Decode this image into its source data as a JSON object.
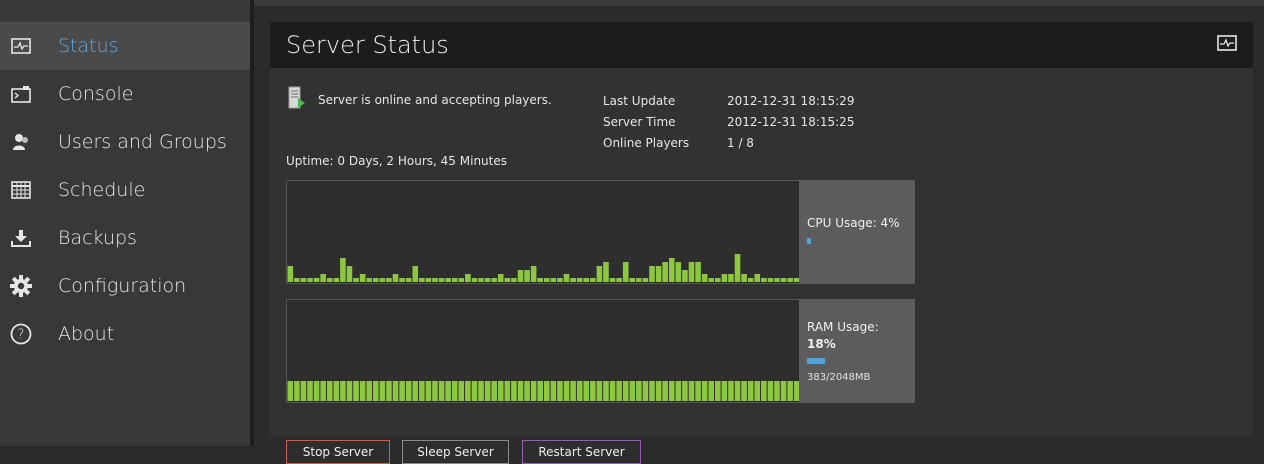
{
  "sidebar": {
    "items": [
      {
        "label": "Status",
        "icon": "activity-monitor-icon",
        "active": true
      },
      {
        "label": "Console",
        "icon": "console-icon"
      },
      {
        "label": "Users and Groups",
        "icon": "users-icon"
      },
      {
        "label": "Schedule",
        "icon": "calendar-grid-icon"
      },
      {
        "label": "Backups",
        "icon": "download-tray-icon"
      },
      {
        "label": "Configuration",
        "icon": "gear-icon"
      },
      {
        "label": "About",
        "icon": "help-circle-icon"
      }
    ]
  },
  "panel": {
    "title": "Server Status",
    "header_icon": "activity-monitor-icon",
    "status_text": "Server is online and accepting players.",
    "uptime": {
      "prefix": "Uptime: ",
      "days": "0",
      "days_unit": " Days, ",
      "hours": "2",
      "hours_unit": " Hours, ",
      "minutes": "45",
      "minutes_unit": " Minutes"
    },
    "info": [
      {
        "key": "Last Update",
        "value": "2012-12-31 18:15:29"
      },
      {
        "key": "Server Time",
        "value": "2012-12-31 18:15:25"
      },
      {
        "key": "Online Players",
        "value": "1 / 8"
      }
    ],
    "cpu": {
      "label": "CPU Usage: 4%",
      "percent": 4,
      "history": [
        4,
        1,
        1,
        1,
        1,
        2,
        1,
        1,
        6,
        4,
        1,
        2,
        1,
        1,
        1,
        1,
        2,
        1,
        1,
        4,
        1,
        1,
        1,
        1,
        1,
        1,
        1,
        2,
        1,
        1,
        1,
        1,
        2,
        1,
        1,
        3,
        3,
        4,
        1,
        1,
        1,
        1,
        2,
        1,
        1,
        1,
        1,
        4,
        5,
        1,
        1,
        5,
        1,
        1,
        1,
        4,
        4,
        5,
        6,
        5,
        3,
        5,
        5,
        2,
        1,
        1,
        2,
        2,
        7,
        2,
        1,
        2,
        1,
        1,
        1,
        1,
        1,
        1
      ],
      "bar_color": "#8dc63f"
    },
    "ram": {
      "label_line1": "RAM Usage:",
      "label_line2": "18%",
      "percent": 18,
      "memory": "383/2048MB",
      "history_value": 18,
      "bar_color": "#8dc63f"
    },
    "buttons": {
      "stop": "Stop Server",
      "sleep": "Sleep Server",
      "restart": "Restart Server"
    },
    "colors": {
      "accent": "#5fa8e8",
      "stop_border": "#d6584a",
      "restart_border": "#9a5bb0"
    }
  }
}
